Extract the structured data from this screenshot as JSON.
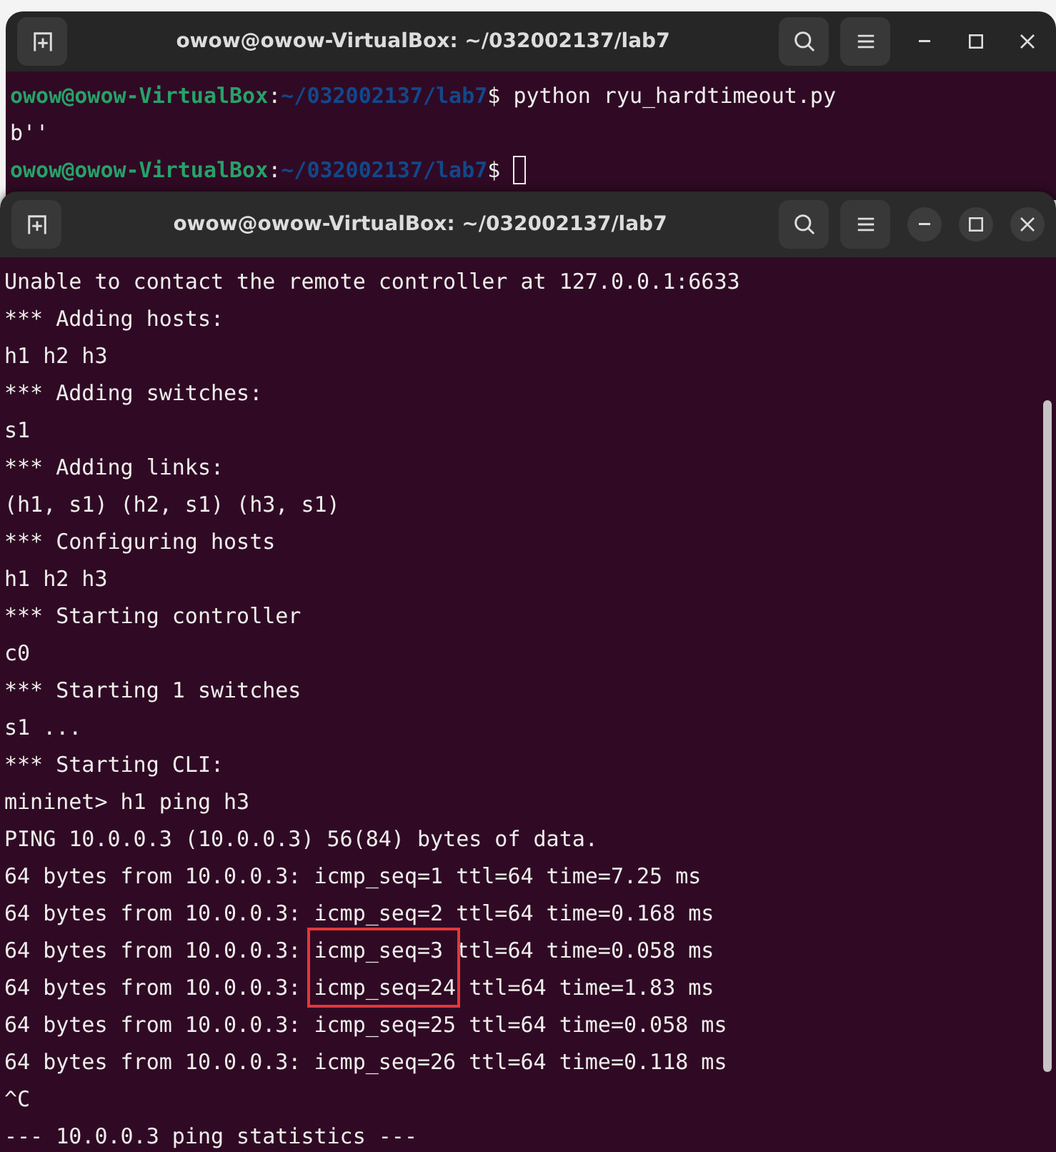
{
  "windows": [
    {
      "title": "owow@owow-VirtualBox: ~/032002137/lab7",
      "focused": false,
      "lines": [
        {
          "kind": "prompt",
          "user": "owow@owow-VirtualBox",
          "sep": ":",
          "path": "~/032002137/lab7",
          "symbol": "$",
          "command": " python ryu_hardtimeout.py",
          "cursor": false
        },
        {
          "kind": "output",
          "text": "b''"
        },
        {
          "kind": "prompt",
          "user": "owow@owow-VirtualBox",
          "sep": ":",
          "path": "~/032002137/lab7",
          "symbol": "$",
          "cursor": true
        }
      ]
    },
    {
      "title": "owow@owow-VirtualBox: ~/032002137/lab7",
      "focused": true,
      "lines": [
        {
          "kind": "output",
          "text": "Unable to contact the remote controller at 127.0.0.1:6633"
        },
        {
          "kind": "output",
          "text": "*** Adding hosts:"
        },
        {
          "kind": "output",
          "text": "h1 h2 h3"
        },
        {
          "kind": "output",
          "text": "*** Adding switches:"
        },
        {
          "kind": "output",
          "text": "s1"
        },
        {
          "kind": "output",
          "text": "*** Adding links:"
        },
        {
          "kind": "output",
          "text": "(h1, s1) (h2, s1) (h3, s1)"
        },
        {
          "kind": "output",
          "text": "*** Configuring hosts"
        },
        {
          "kind": "output",
          "text": "h1 h2 h3"
        },
        {
          "kind": "output",
          "text": "*** Starting controller"
        },
        {
          "kind": "output",
          "text": "c0"
        },
        {
          "kind": "output",
          "text": "*** Starting 1 switches"
        },
        {
          "kind": "output",
          "text": "s1 ..."
        },
        {
          "kind": "output",
          "text": "*** Starting CLI:"
        },
        {
          "kind": "output",
          "text": "mininet> h1 ping h3"
        },
        {
          "kind": "output",
          "text": "PING 10.0.0.3 (10.0.0.3) 56(84) bytes of data."
        },
        {
          "kind": "output",
          "text": "64 bytes from 10.0.0.3: icmp_seq=1 ttl=64 time=7.25 ms"
        },
        {
          "kind": "output",
          "text": "64 bytes from 10.0.0.3: icmp_seq=2 ttl=64 time=0.168 ms"
        },
        {
          "kind": "boxed",
          "before": "64 bytes from 10.0.0.3: ",
          "boxed": "icmp_seq=3",
          "after": " ttl=64 time=0.058 ms"
        },
        {
          "kind": "boxed",
          "before": "64 bytes from 10.0.0.3: ",
          "boxed": "icmp_seq=24",
          "after": " ttl=64 time=1.83 ms"
        },
        {
          "kind": "output",
          "text": "64 bytes from 10.0.0.3: icmp_seq=25 ttl=64 time=0.058 ms"
        },
        {
          "kind": "output",
          "text": "64 bytes from 10.0.0.3: icmp_seq=26 ttl=64 time=0.118 ms"
        },
        {
          "kind": "output",
          "text": "^C"
        },
        {
          "kind": "output",
          "text": "--- 10.0.0.3 ping statistics ---"
        }
      ]
    }
  ]
}
